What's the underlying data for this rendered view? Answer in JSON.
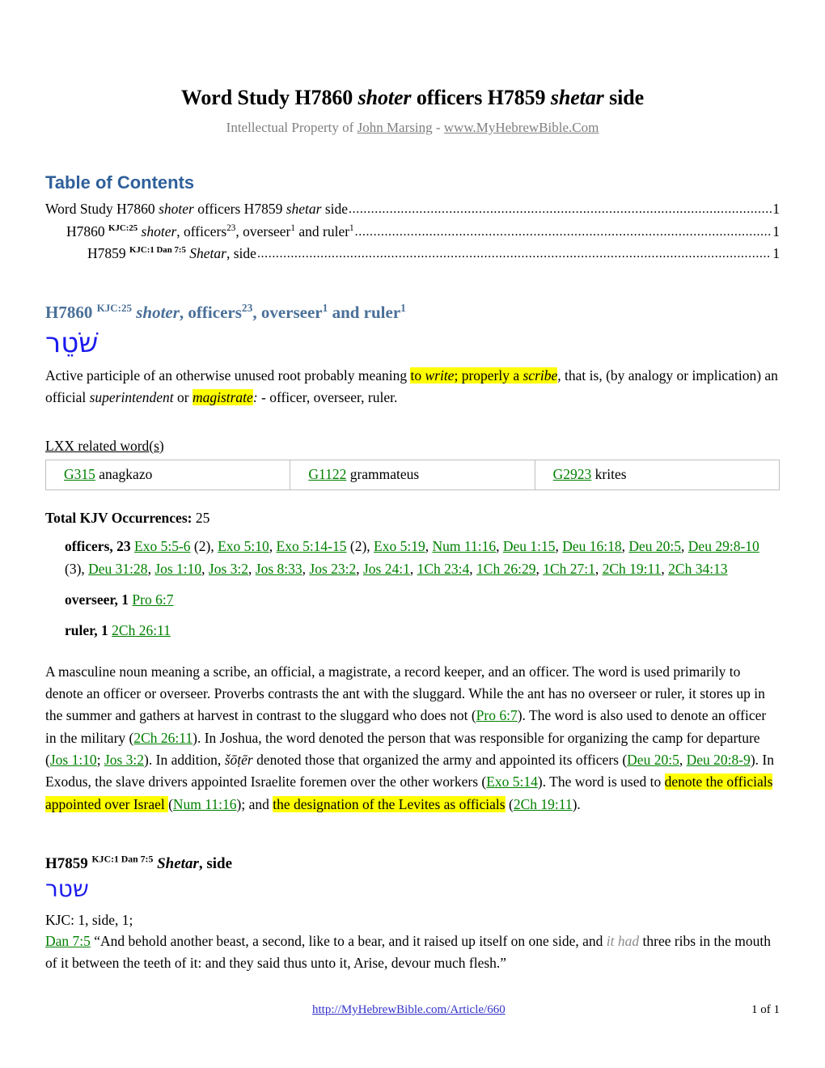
{
  "document": {
    "title_parts": [
      {
        "text": "Word Study H7860 ",
        "style": "bold"
      },
      {
        "text": "shoter",
        "style": "bold-italic"
      },
      {
        "text": " officers H7859 ",
        "style": "bold"
      },
      {
        "text": "shetar",
        "style": "bold-italic"
      },
      {
        "text": " side",
        "style": "bold"
      }
    ],
    "title_plain": "Word Study H7860 shoter officers H7859 shetar side",
    "subtitle_prefix": "Intellectual Property of ",
    "subtitle_author": "John Marsing",
    "subtitle_separator": " - ",
    "subtitle_site": "www.MyHebrewBible.Com"
  },
  "toc": {
    "heading": "Table of Contents",
    "heading_color": "#2e5f9a",
    "entries": [
      {
        "level": 1,
        "text_plain": "Word Study H7860 shoter officers H7859 shetar side",
        "pre": "Word Study H7860 ",
        "italic1": "shoter",
        "mid": " officers H7859 ",
        "italic2": "shetar",
        "post": " side",
        "page": "1"
      },
      {
        "level": 2,
        "text_plain": "H7860 KJC:25 shoter, officers23, overseer1 and ruler1",
        "pre": "H7860 ",
        "sup_kjc": "KJC:25",
        "italic1": "shoter",
        "mid": ", officers",
        "sup_a": "23",
        "mid2": ", overseer",
        "sup_b": "1",
        "mid3": " and ruler",
        "sup_c": "1",
        "page": "1"
      },
      {
        "level": 3,
        "text_plain": "H7859 KJC:1 Dan 7:5 Shetar, side",
        "pre": "H7859 ",
        "sup_kjc": "KJC:1 Dan 7:5",
        "italic1": "Shetar",
        "post": ", side",
        "page": "1"
      }
    ]
  },
  "section_h7860": {
    "heading_pre": "H7860 ",
    "heading_sup": "KJC:25",
    "heading_italic": "shoter",
    "heading_mid": ", officers",
    "heading_sup_a": "23",
    "heading_mid2": ", overseer",
    "heading_sup_b": "1",
    "heading_mid3": " and ruler",
    "heading_sup_c": "1",
    "heading_color": "#4a7099",
    "hebrew": "שֹׁטֵר",
    "hebrew_color": "#1a1aee",
    "definition": {
      "seg1": "Active participle of an otherwise unused root probably meaning ",
      "hl1_pre": "to ",
      "hl1_italic": "write",
      "hl1_mid": "; properly a ",
      "hl1_italic2": "scribe",
      "seg2": ", that is, (by analogy or implication) an official ",
      "italic_superintendent": "superintendent",
      "seg3": " or ",
      "hl2_italic": "magistrate",
      "hl2_colon": ":",
      "seg4": " - officer, overseer, ruler."
    },
    "lxx": {
      "label": "LXX related word(s)",
      "rows": [
        [
          {
            "ref": "G315",
            "word": "anagkazo"
          },
          {
            "ref": "G1122",
            "word": "grammateus"
          },
          {
            "ref": "G2923",
            "word": "krites"
          }
        ]
      ]
    },
    "occurrences": {
      "total_label": "Total KJV Occurrences:",
      "total_value": "25",
      "groups": [
        {
          "label": "officers, 23",
          "refs": [
            {
              "ref": "Exo 5:5-6",
              "count": " (2)",
              "sep": ", "
            },
            {
              "ref": "Exo 5:10",
              "count": "",
              "sep": ", "
            },
            {
              "ref": "Exo 5:14-15",
              "count": " (2)",
              "sep": ", "
            },
            {
              "ref": "Exo 5:19",
              "count": "",
              "sep": ", "
            },
            {
              "ref": "Num 11:16",
              "count": "",
              "sep": ", "
            },
            {
              "ref": "Deu 1:15",
              "count": "",
              "sep": ", "
            },
            {
              "ref": "Deu 16:18",
              "count": "",
              "sep": ", "
            },
            {
              "ref": "Deu 20:5",
              "count": "",
              "sep": ", "
            },
            {
              "ref": "Deu 29:8-10",
              "count": " (3)",
              "sep": ", "
            },
            {
              "ref": "Deu 31:28",
              "count": "",
              "sep": ", "
            },
            {
              "ref": "Jos 1:10",
              "count": "",
              "sep": ", "
            },
            {
              "ref": "Jos 3:2",
              "count": "",
              "sep": ", "
            },
            {
              "ref": "Jos 8:33",
              "count": "",
              "sep": ", "
            },
            {
              "ref": "Jos 23:2",
              "count": "",
              "sep": ", "
            },
            {
              "ref": "Jos 24:1",
              "count": "",
              "sep": ", "
            },
            {
              "ref": "1Ch 23:4",
              "count": "",
              "sep": ", "
            },
            {
              "ref": "1Ch 26:29",
              "count": "",
              "sep": ", "
            },
            {
              "ref": "1Ch 27:1",
              "count": "",
              "sep": ", "
            },
            {
              "ref": "2Ch 19:11",
              "count": "",
              "sep": ", "
            },
            {
              "ref": "2Ch 34:13",
              "count": "",
              "sep": ""
            }
          ]
        },
        {
          "label": "overseer, 1",
          "refs": [
            {
              "ref": "Pro 6:7",
              "count": "",
              "sep": ""
            }
          ]
        },
        {
          "label": "ruler, 1",
          "refs": [
            {
              "ref": "2Ch 26:11",
              "count": "",
              "sep": ""
            }
          ]
        }
      ]
    },
    "commentary": {
      "p1": "A masculine noun meaning a scribe, an official, a magistrate, a record keeper, and an officer. The word is used primarily to denote an officer or overseer. Proverbs contrasts the ant with the sluggard. While the ant has no overseer or ruler, it stores up in the summer and gathers at harvest in contrast to the sluggard who does not (",
      "ref1": "Pro 6:7",
      "p2": "). The word is also used to denote an officer in the military (",
      "ref2": "2Ch 26:11",
      "p3": "). In Joshua, the word denoted the person that was responsible for organizing the camp for departure (",
      "ref3": "Jos 1:10",
      "p3b": "; ",
      "ref4": "Jos 3:2",
      "p4": "). In addition, ",
      "translit": "šōṭēr",
      "p5": " denoted those that organized the army and appointed its officers (",
      "ref5": "Deu 20:5",
      "p5b": ", ",
      "ref6": "Deu 20:8-9",
      "p6": "). In Exodus, the slave drivers appointed Israelite foremen over the other workers (",
      "ref7": "Exo 5:14",
      "p7": "). The word is used to ",
      "hl_a": "denote the officials appointed over Israel ",
      "p8": "(",
      "ref8": "Num 11:16",
      "p9": "); and ",
      "hl_b": "the designation of the Levites as officials",
      "p10": " (",
      "ref9": "2Ch 19:11",
      "p11": ")."
    }
  },
  "section_h7859": {
    "heading_pre": "H7859 ",
    "heading_sup": "KJC:1 Dan 7:5",
    "heading_italic": "Shetar",
    "heading_post": ", side",
    "hebrew": "שטר",
    "hebrew_color": "#1a1aee",
    "kjc_line": "KJC: 1, side, 1;",
    "verse": {
      "ref": "Dan 7:5",
      "text_a": " “And behold another beast, a second, like to a bear, and it raised up itself on one side, and ",
      "italic_gray": "it had",
      "text_b": " three ribs in the mouth of it between the teeth of it: and they said thus unto it, Arise, devour much flesh.”"
    }
  },
  "footer": {
    "url": "http://MyHebrewBible.com/Article/660",
    "page_label": "1 of 1"
  },
  "colors": {
    "link_green": "#008000",
    "link_blue": "#3333cc",
    "heading_blue": "#2e5f9a",
    "heading_slate": "#4a7099",
    "hebrew_blue": "#1a1aee",
    "highlight_yellow": "#ffff00",
    "subtitle_gray": "#808080",
    "table_border": "#bfbfbf"
  }
}
